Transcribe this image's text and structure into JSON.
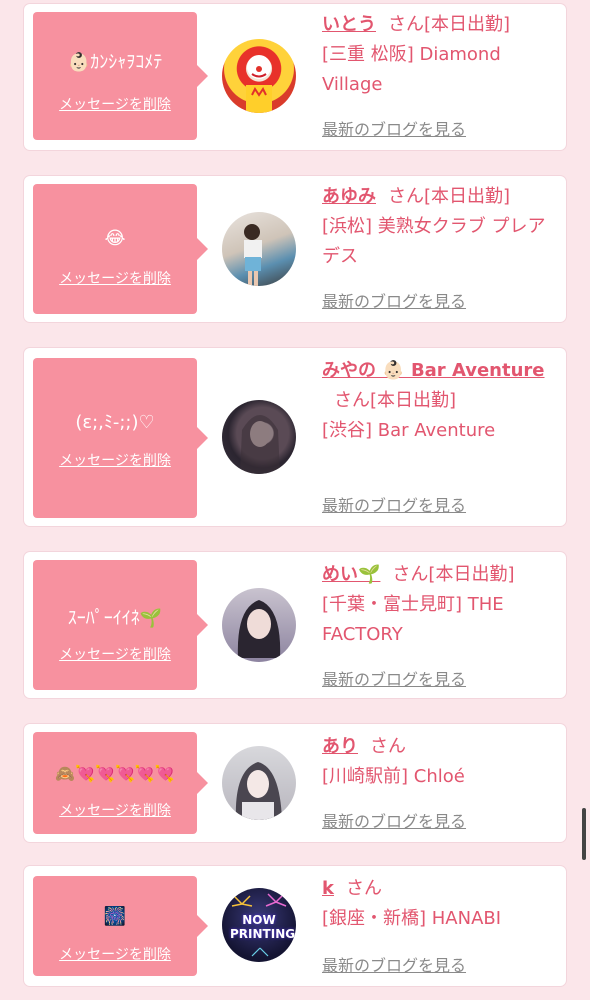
{
  "delete_label": "メッセージを削除",
  "blog_label": "最新のブログを見る",
  "cards": [
    {
      "bubble_text": "👶🏻ｶﾝｼｬｦｺﾒﾃ",
      "name": "いとう",
      "suffix": "さん[本日出勤]",
      "shop": "[三重 松阪] Diamond Village",
      "avatar_icon": "clown-avatar-icon"
    },
    {
      "bubble_text": "😂",
      "name": "あゆみ",
      "suffix": "さん[本日出勤]",
      "shop": "[浜松] 美熟女クラブ プレアデス",
      "avatar_icon": "woman-photo-avatar-icon"
    },
    {
      "bubble_text": "(ε;,ﾐ-;;)♡",
      "name": "みやの 👶🏻 Bar Aventure",
      "suffix": "さん[本日出勤]",
      "shop": "[渋谷] Bar Aventure",
      "avatar_icon": "woman-photo-avatar-icon"
    },
    {
      "bubble_text": "ｽｰﾊﾟｰｲｲﾈ🌱",
      "name": "めい🌱",
      "suffix": "さん[本日出勤]",
      "shop": "[千葉・富士見町] THE FACTORY",
      "avatar_icon": "woman-photo-avatar-icon"
    },
    {
      "bubble_text": "🙈💘💘💘💘💘",
      "name": "あり",
      "suffix": "さん",
      "shop": "[川崎駅前] Chloé",
      "avatar_icon": "woman-photo-avatar-icon"
    },
    {
      "bubble_text": "🎆",
      "name": "k",
      "suffix": "さん",
      "shop": "[銀座・新橋] HANABI",
      "avatar_icon": "fireworks-avatar-icon",
      "avatar_overlay": "NOW PRINTING"
    }
  ]
}
